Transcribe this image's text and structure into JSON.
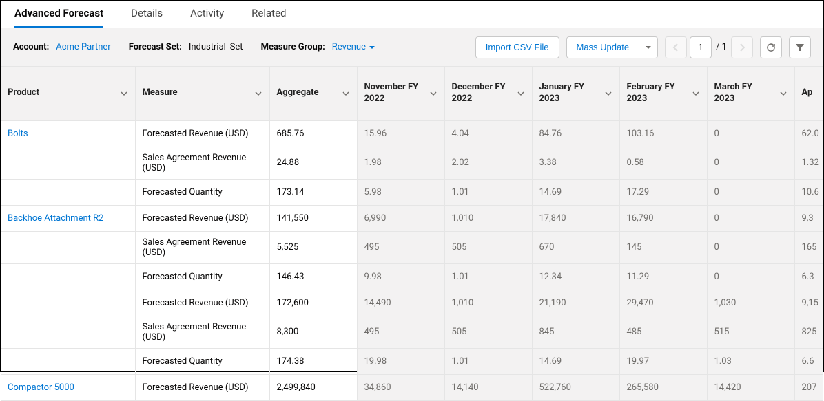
{
  "tabs": [
    "Advanced Forecast",
    "Details",
    "Activity",
    "Related"
  ],
  "active_tab": 0,
  "toolbar": {
    "account_label": "Account:",
    "account_value": "Acme Partner",
    "forecast_set_label": "Forecast Set:",
    "forecast_set_value": "Industrial_Set",
    "measure_group_label": "Measure Group:",
    "measure_group_value": "Revenue",
    "import_label": "Import CSV File",
    "mass_update_label": "Mass Update",
    "page_current": "1",
    "page_total": "/ 1"
  },
  "columns": {
    "product": "Product",
    "measure": "Measure",
    "aggregate": "Aggregate",
    "months": [
      "November FY 2022",
      "December FY 2022",
      "January FY 2023",
      "February FY 2023",
      "March FY 2023",
      "Ap"
    ]
  },
  "rows": [
    {
      "product": "Bolts",
      "measure": "Forecasted Revenue (USD)",
      "aggregate": "685.76",
      "cells": [
        "15.96",
        "4.04",
        "84.76",
        "103.16",
        "0",
        "62.0"
      ]
    },
    {
      "product": "",
      "measure": "Sales Agreement Revenue (USD)",
      "aggregate": "24.88",
      "cells": [
        "1.98",
        "2.02",
        "3.38",
        "0.58",
        "0",
        "1.32"
      ]
    },
    {
      "product": "",
      "measure": "Forecasted Quantity",
      "aggregate": "173.14",
      "cells": [
        "5.98",
        "1.01",
        "14.69",
        "17.29",
        "0",
        "10.6"
      ]
    },
    {
      "product": "Backhoe Attachment R2",
      "measure": "Forecasted Revenue (USD)",
      "aggregate": "141,550",
      "cells": [
        "6,990",
        "1,010",
        "17,840",
        "16,790",
        "0",
        "9,3"
      ]
    },
    {
      "product": "",
      "measure": "Sales Agreement Revenue (USD)",
      "aggregate": "5,525",
      "cells": [
        "495",
        "505",
        "670",
        "145",
        "0",
        "165"
      ]
    },
    {
      "product": "",
      "measure": "Forecasted Quantity",
      "aggregate": "146.43",
      "cells": [
        "9.98",
        "1.01",
        "12.34",
        "11.29",
        "0",
        "6.3"
      ]
    },
    {
      "product": "",
      "measure": "Forecasted Revenue (USD)",
      "aggregate": "172,600",
      "cells": [
        "14,490",
        "1,010",
        "21,190",
        "29,470",
        "1,030",
        "9,15"
      ]
    },
    {
      "product": "",
      "measure": "Sales Agreement Revenue (USD)",
      "aggregate": "8,300",
      "cells": [
        "495",
        "505",
        "845",
        "485",
        "515",
        "825"
      ]
    },
    {
      "product": "",
      "measure": "Forecasted Quantity",
      "aggregate": "174.38",
      "cells": [
        "19.98",
        "1.01",
        "14.69",
        "19.97",
        "1.03",
        "6.6"
      ]
    },
    {
      "product": "Compactor 5000",
      "measure": "Forecasted Revenue (USD)",
      "aggregate": "2,499,840",
      "cells": [
        "34,860",
        "14,140",
        "522,760",
        "265,580",
        "14,420",
        "207"
      ]
    }
  ]
}
